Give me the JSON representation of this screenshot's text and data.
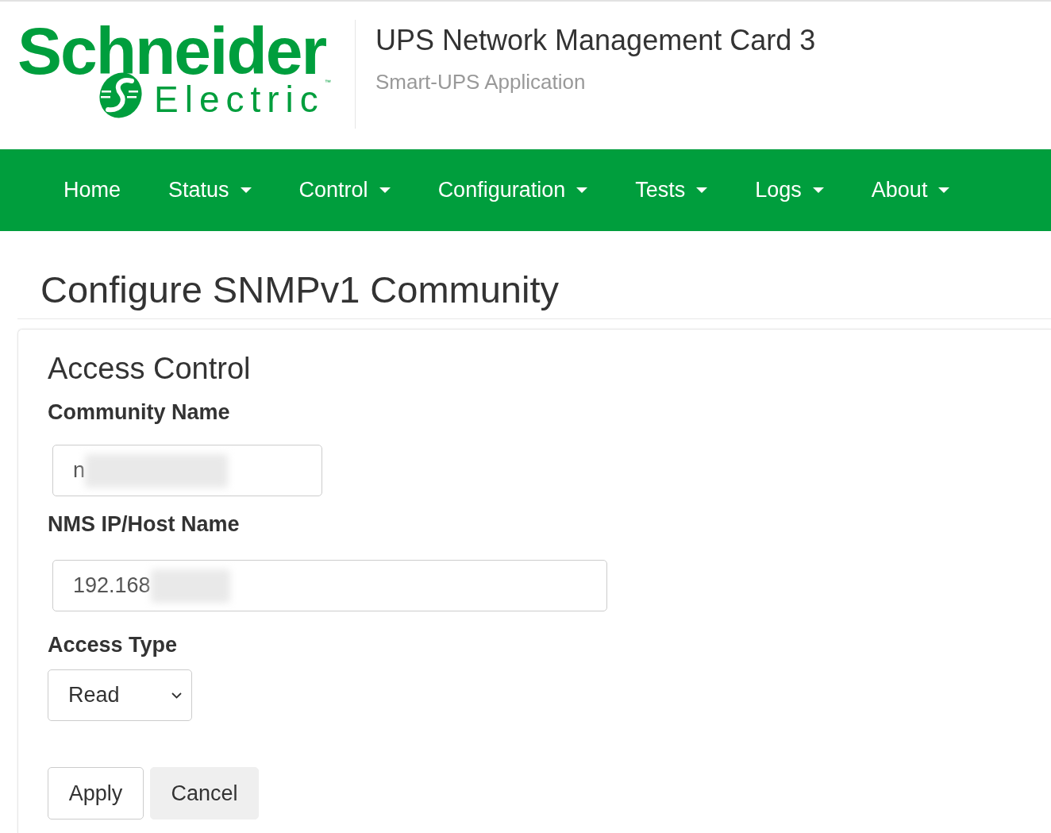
{
  "header": {
    "logo": {
      "line_1": "Schneider",
      "line_2": "Electric",
      "trademark": "™"
    },
    "title": "UPS Network Management Card 3",
    "subtitle": "Smart-UPS Application"
  },
  "nav": [
    {
      "label": "Home",
      "dropdown": false
    },
    {
      "label": "Status",
      "dropdown": true
    },
    {
      "label": "Control",
      "dropdown": true
    },
    {
      "label": "Configuration",
      "dropdown": true
    },
    {
      "label": "Tests",
      "dropdown": true
    },
    {
      "label": "Logs",
      "dropdown": true
    },
    {
      "label": "About",
      "dropdown": true
    }
  ],
  "page_title": "Configure SNMPv1 Community",
  "panel": {
    "heading": "Access Control",
    "fields": [
      {
        "kind": "text",
        "label": "Community Name",
        "value": "n",
        "redacted": true
      },
      {
        "kind": "text",
        "label": "NMS IP/Host Name",
        "value": "192.168",
        "redacted": true
      },
      {
        "kind": "select",
        "label": "Access Type",
        "value": "Read"
      }
    ],
    "buttons": [
      {
        "label": "Apply",
        "kind": "outlined"
      },
      {
        "label": "Cancel",
        "kind": "filled"
      }
    ]
  }
}
